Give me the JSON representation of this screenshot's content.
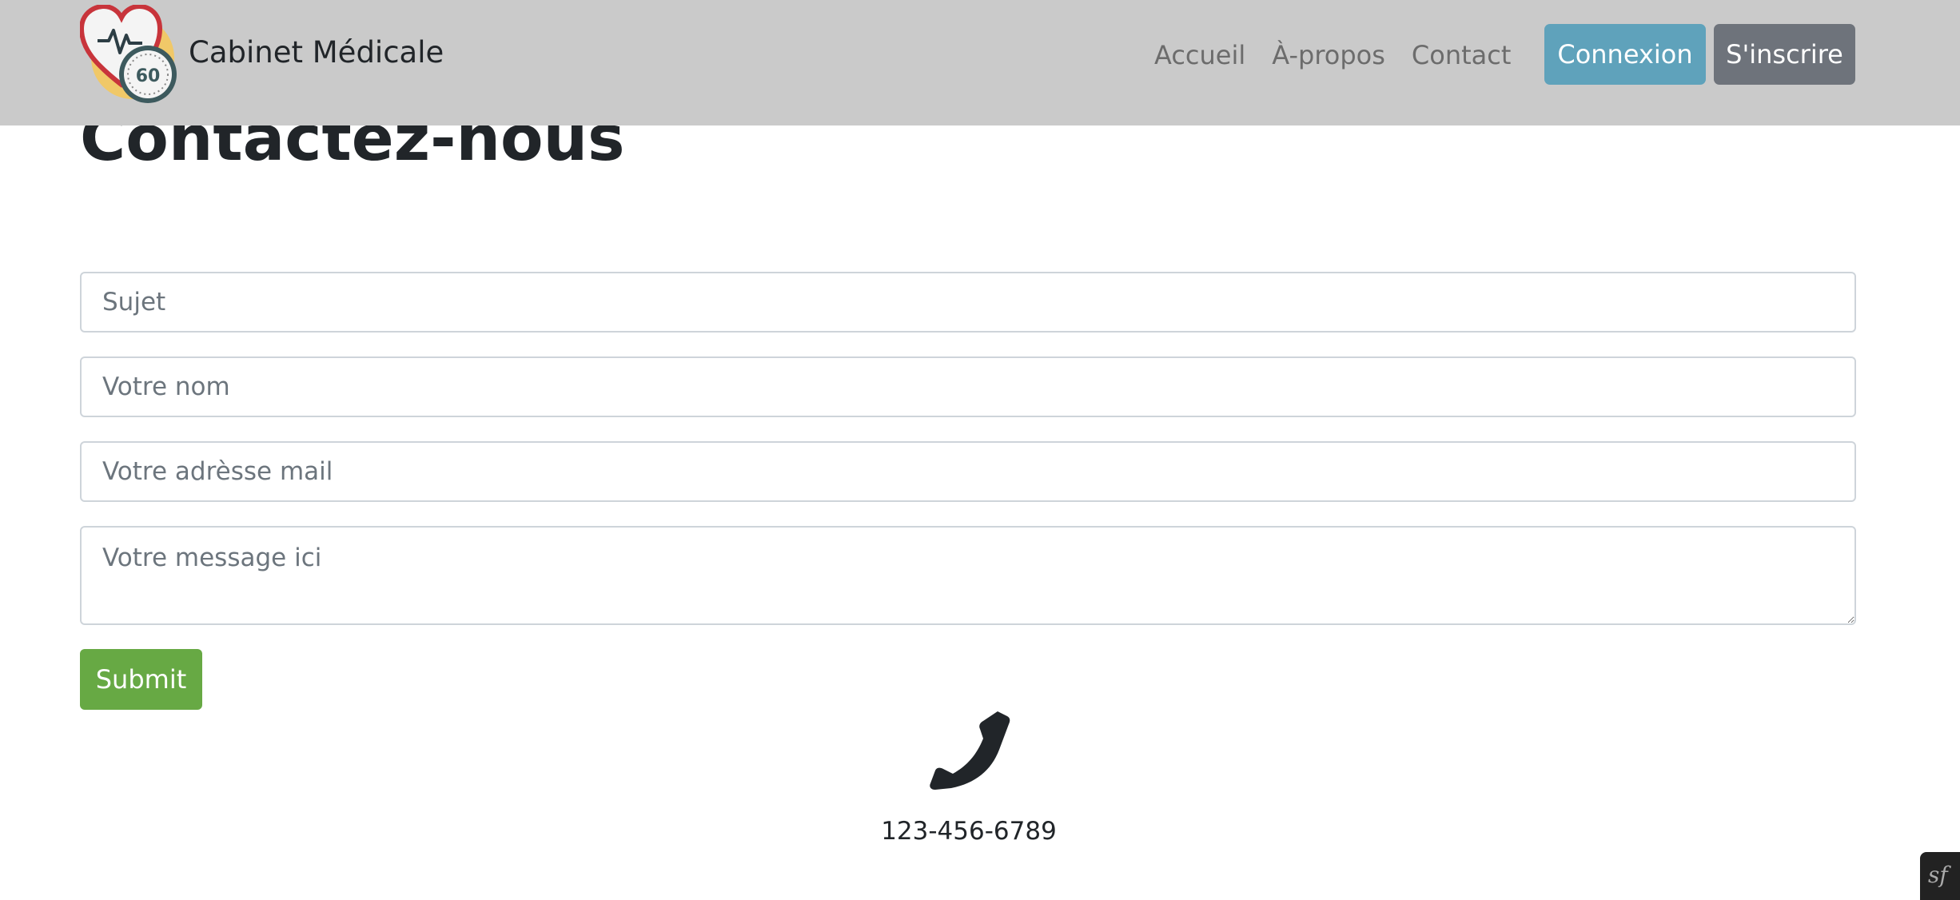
{
  "brand": {
    "name": "Cabinet Médicale",
    "logo_badge": "60"
  },
  "nav": {
    "links": [
      "Accueil",
      "À-propos",
      "Contact"
    ],
    "login_label": "Connexion",
    "signup_label": "S'inscrire"
  },
  "page": {
    "title": "Contactez-nous"
  },
  "form": {
    "subject_placeholder": "Sujet",
    "name_placeholder": "Votre nom",
    "email_placeholder": "Votre adrèsse mail",
    "message_placeholder": "Votre message ici",
    "submit_label": "Submit"
  },
  "contact": {
    "phone": "123-456-6789",
    "icon": "phone-icon"
  },
  "colors": {
    "navbar_bg": "#cacaca",
    "login_button": "#5fa2bb",
    "signup_button": "#6e737b",
    "submit_button": "#67a944"
  }
}
